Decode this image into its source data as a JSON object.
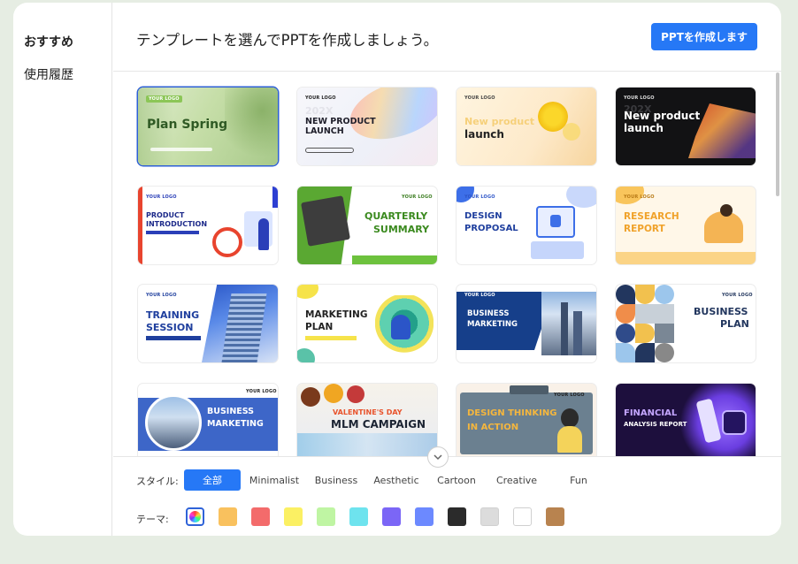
{
  "sidebar": {
    "items": [
      {
        "label": "おすすめ"
      },
      {
        "label": "使用履歴"
      }
    ]
  },
  "header": {
    "title": "テンプレートを選んでPPTを作成しましょう。",
    "create_button": "PPTを作成します"
  },
  "templates": [
    {
      "logo": "YOUR LOGO",
      "t1": "Plan Spring"
    },
    {
      "logo": "YOUR LOGO",
      "t1": "202X",
      "t2": "NEW PRODUCT LAUNCH"
    },
    {
      "logo": "YOUR LOGO",
      "t1": "New product",
      "t2": "launch"
    },
    {
      "logo": "YOUR LOGO",
      "t1": "202X",
      "t2": "New product launch"
    },
    {
      "logo": "YOUR LOGO",
      "t1": "PRODUCT",
      "t2": "INTRODUCTION"
    },
    {
      "logo": "YOUR LOGO",
      "t1": "QUARTERLY",
      "t2": "SUMMARY"
    },
    {
      "logo": "YOUR LOGO",
      "t1": "DESIGN",
      "t2": "PROPOSAL"
    },
    {
      "logo": "YOUR LOGO",
      "t1": "RESEARCH",
      "t2": "REPORT"
    },
    {
      "logo": "YOUR LOGO",
      "t1": "TRAINING",
      "t2": "SESSION"
    },
    {
      "logo": "YOUR LOGO",
      "t1": "MARKETING",
      "t2": "PLAN"
    },
    {
      "logo": "YOUR LOGO",
      "t1": "BUSINESS",
      "t2": "MARKETING"
    },
    {
      "logo": "YOUR LOGO",
      "t1": "BUSINESS",
      "t2": "PLAN"
    },
    {
      "logo": "YOUR LOGO",
      "t1": "BUSINESS",
      "t2": "MARKETING"
    },
    {
      "logo": "",
      "t1": "VALENTINE'S DAY",
      "t2": "MLM CAMPAIGN"
    },
    {
      "logo": "YOUR LOGO",
      "t1": "DESIGN THINKING",
      "t2": "IN ACTION"
    },
    {
      "logo": "",
      "t1": "FINANCIAL",
      "t2": "ANALYSIS REPORT"
    }
  ],
  "footer": {
    "style_label": "スタイル:",
    "theme_label": "テーマ:",
    "styles": [
      "全部",
      "Minimalist",
      "Business",
      "Aesthetic",
      "Cartoon",
      "Creative",
      "Fun"
    ],
    "active_style": "全部",
    "theme_colors": [
      "#f9c15e",
      "#f36b6b",
      "#fbf063",
      "#bff5a3",
      "#6ee3ee",
      "#7b66f6",
      "#6c89ff",
      "#2b2b2b",
      "#dcdcdc",
      "#ffffff",
      "#b8834f"
    ]
  }
}
